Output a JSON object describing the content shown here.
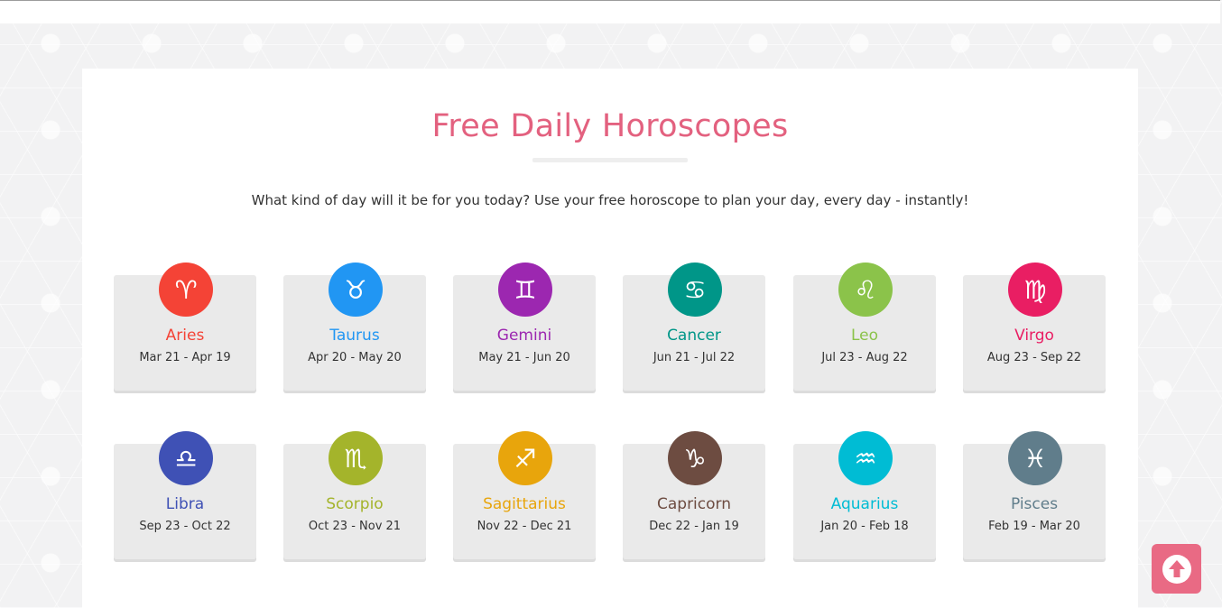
{
  "header": {
    "title": "Free Daily Horoscopes",
    "subtitle": "What kind of day will it be for you today? Use your free horoscope to plan your day, every day - instantly!"
  },
  "signs": [
    {
      "name": "Aries",
      "dates": "Mar 21 - Apr 19",
      "glyph": "♈",
      "color": "#f44336",
      "icon": "aries-icon"
    },
    {
      "name": "Taurus",
      "dates": "Apr 20 - May 20",
      "glyph": "♉",
      "color": "#2196f3",
      "icon": "taurus-icon"
    },
    {
      "name": "Gemini",
      "dates": "May 21 - Jun 20",
      "glyph": "♊",
      "color": "#9c27b0",
      "icon": "gemini-icon"
    },
    {
      "name": "Cancer",
      "dates": "Jun 21 - Jul 22",
      "glyph": "♋",
      "color": "#009688",
      "icon": "cancer-icon"
    },
    {
      "name": "Leo",
      "dates": "Jul 23 - Aug 22",
      "glyph": "♌",
      "color": "#8bc34a",
      "icon": "leo-icon"
    },
    {
      "name": "Virgo",
      "dates": "Aug 23 - Sep 22",
      "glyph": "♍",
      "color": "#e91e63",
      "icon": "virgo-icon"
    },
    {
      "name": "Libra",
      "dates": "Sep 23 - Oct 22",
      "glyph": "♎",
      "color": "#3f51b5",
      "icon": "libra-icon"
    },
    {
      "name": "Scorpio",
      "dates": "Oct 23 - Nov 21",
      "glyph": "♏",
      "color": "#a4b42b",
      "icon": "scorpio-icon"
    },
    {
      "name": "Sagittarius",
      "dates": "Nov 22 - Dec 21",
      "glyph": "♐",
      "color": "#e8a50c",
      "icon": "sagittarius-icon"
    },
    {
      "name": "Capricorn",
      "dates": "Dec 22 - Jan 19",
      "glyph": "♑",
      "color": "#6d4c41",
      "icon": "capricorn-icon"
    },
    {
      "name": "Aquarius",
      "dates": "Jan 20 - Feb 18",
      "glyph": "♒",
      "color": "#00bcd4",
      "icon": "aquarius-icon"
    },
    {
      "name": "Pisces",
      "dates": "Feb 19 - Mar 20",
      "glyph": "♓",
      "color": "#607d8b",
      "icon": "pisces-icon"
    }
  ],
  "scroll_top": {
    "icon": "arrow-up-circle-icon",
    "color": "#e96a84"
  }
}
